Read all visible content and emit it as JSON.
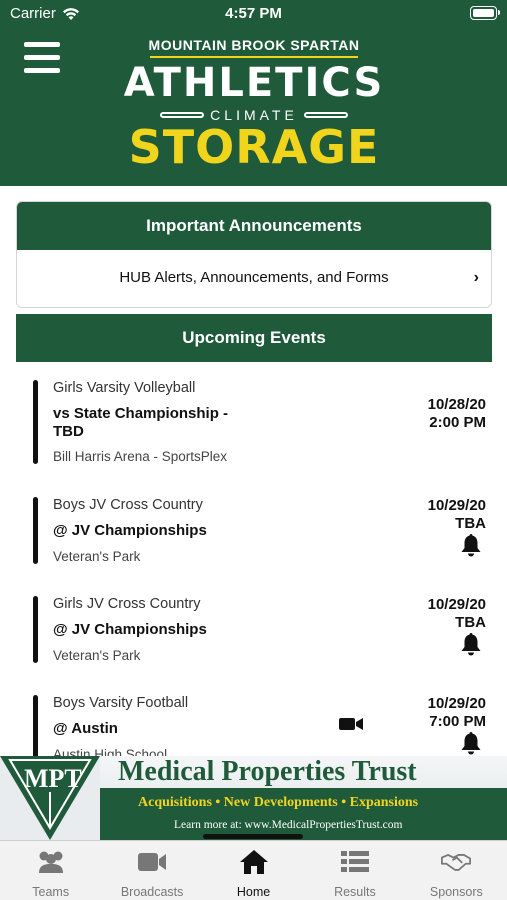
{
  "status_bar": {
    "carrier": "Carrier",
    "time": "4:57 PM"
  },
  "header": {
    "logo_top": "MOUNTAIN BROOK SPARTAN",
    "logo_main": "ATHLETICS",
    "logo_sponsor": "CLIMATE",
    "logo_storage": "STORAGE"
  },
  "announcements": {
    "title": "Important Announcements",
    "row_label": "HUB Alerts, Announcements, and Forms"
  },
  "events": {
    "title": "Upcoming Events",
    "items": [
      {
        "sport": "Girls Varsity Volleyball",
        "title": "vs State Championship - TBD",
        "location": "Bill Harris Arena - SportsPlex",
        "date": "10/28/20",
        "time": "2:00 PM",
        "bell": false,
        "camera": false
      },
      {
        "sport": "Boys JV Cross Country",
        "title": "@ JV Championships",
        "location": "Veteran's Park",
        "date": "10/29/20",
        "time": "TBA",
        "bell": true,
        "camera": false
      },
      {
        "sport": "Girls JV Cross Country",
        "title": "@ JV Championships",
        "location": "Veteran's Park",
        "date": "10/29/20",
        "time": "TBA",
        "bell": true,
        "camera": false
      },
      {
        "sport": "Boys Varsity Football",
        "title": "@ Austin",
        "location": "Austin High School",
        "date": "10/29/20",
        "time": "7:00 PM",
        "bell": true,
        "camera": true
      }
    ]
  },
  "ad": {
    "logo": "MPT",
    "name_part1": "Medical Properties ",
    "name_part2": "Trust",
    "tagline": "Acquisitions • New Developments • Expansions",
    "link": "Learn more at: www.MedicalPropertiesTrust.com"
  },
  "tabs": [
    {
      "label": "Teams",
      "icon": "teams-icon",
      "active": false
    },
    {
      "label": "Broadcasts",
      "icon": "video-camera-icon",
      "active": false
    },
    {
      "label": "Home",
      "icon": "home-icon",
      "active": true
    },
    {
      "label": "Results",
      "icon": "list-icon",
      "active": false
    },
    {
      "label": "Sponsors",
      "icon": "handshake-icon",
      "active": false
    }
  ],
  "colors": {
    "brand_green": "#1f5a3a",
    "brand_yellow": "#f1d51d"
  }
}
